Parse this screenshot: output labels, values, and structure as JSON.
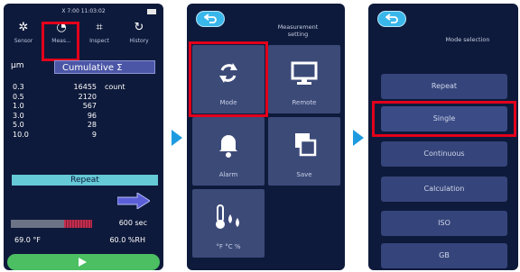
{
  "panel1": {
    "status_time": "X 7:00 11:03:02",
    "tabs": [
      {
        "label": "Sensor",
        "icon": "gear-icon"
      },
      {
        "label": "Meas...",
        "icon": "gauge-icon"
      },
      {
        "label": "Inspect",
        "icon": "inspect-icon"
      },
      {
        "label": "History",
        "icon": "history-icon"
      }
    ],
    "unit": "μm",
    "cumulative_label": "Cumulative Σ",
    "rows": [
      {
        "size": "0.3",
        "count": "16455",
        "unit": "count"
      },
      {
        "size": "0.5",
        "count": "2120",
        "unit": ""
      },
      {
        "size": "1.0",
        "count": "567",
        "unit": ""
      },
      {
        "size": "3.0",
        "count": "96",
        "unit": ""
      },
      {
        "size": "5.0",
        "count": "28",
        "unit": ""
      },
      {
        "size": "10.0",
        "count": "9",
        "unit": ""
      }
    ],
    "mode": "Repeat",
    "progress_fraction": 0.35,
    "seconds": "600 sec",
    "temperature": "69.0 °F",
    "humidity": "60.0 %RH"
  },
  "panel2": {
    "title": "Measurement\nsetting",
    "tiles": [
      {
        "label": "Mode",
        "icon": "refresh-icon"
      },
      {
        "label": "Remote",
        "icon": "monitor-icon"
      },
      {
        "label": "Alarm",
        "icon": "bell-icon"
      },
      {
        "label": "Save",
        "icon": "copy-icon"
      },
      {
        "label": "°F °C %",
        "icon": "thermometer-icon"
      }
    ]
  },
  "panel3": {
    "title": "Mode selection",
    "options": [
      "Repeat",
      "Single",
      "Continuous",
      "Calculation",
      "ISO",
      "GB"
    ],
    "selected": "Single"
  },
  "colors": {
    "background": "#0e1a3b",
    "highlight": "#e3001b",
    "accent": "#3ab7ea",
    "start": "#4bbf62"
  }
}
